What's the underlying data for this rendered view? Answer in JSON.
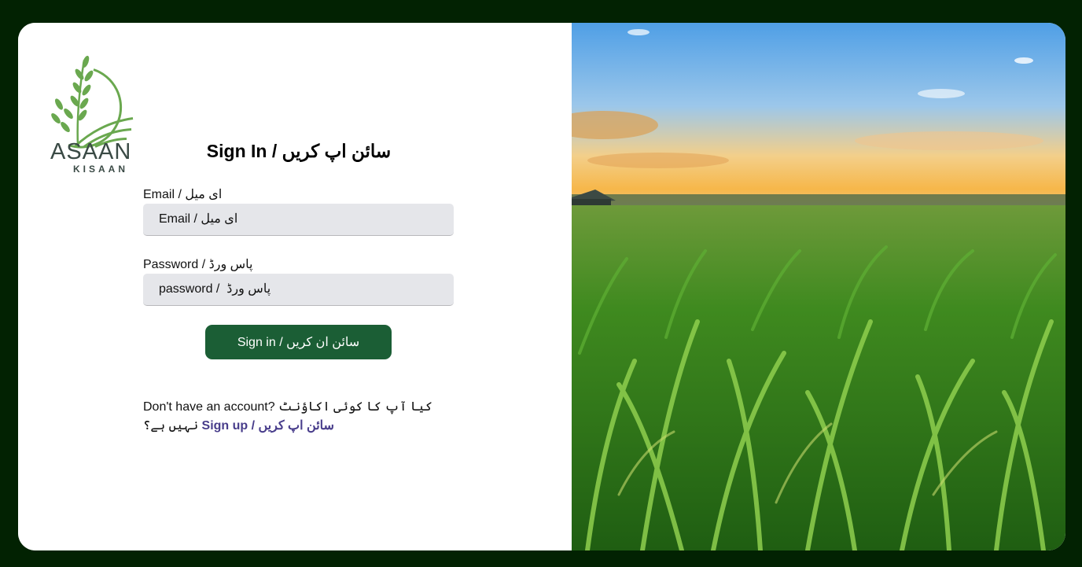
{
  "brand": {
    "name": "ASAAN",
    "tagline": "KISAAN"
  },
  "form": {
    "title": "Sign In / سائن اپ کریں",
    "email_label": "Email / ای میل",
    "email_placeholder": "Email / ای میل",
    "password_label": "Password / پاس ورڈ",
    "password_placeholder": "password /  پاس ورڈ",
    "submit_label": "Sign in / سائن ان کریں"
  },
  "signup": {
    "prompt": "Don't have an account? کیا آپ کا کوئی اکاؤنٹ نہیں ہے؟ ",
    "link_label": "Sign up / سائن اپ کریں"
  },
  "colors": {
    "page_background": "#022202",
    "button_green": "#1b5e35",
    "link_color": "#483d8b",
    "logo_green": "#6aa84f"
  },
  "icons": {
    "logo": "wheat-field-logo-icon",
    "hero": "cornfield-sunset-image"
  }
}
